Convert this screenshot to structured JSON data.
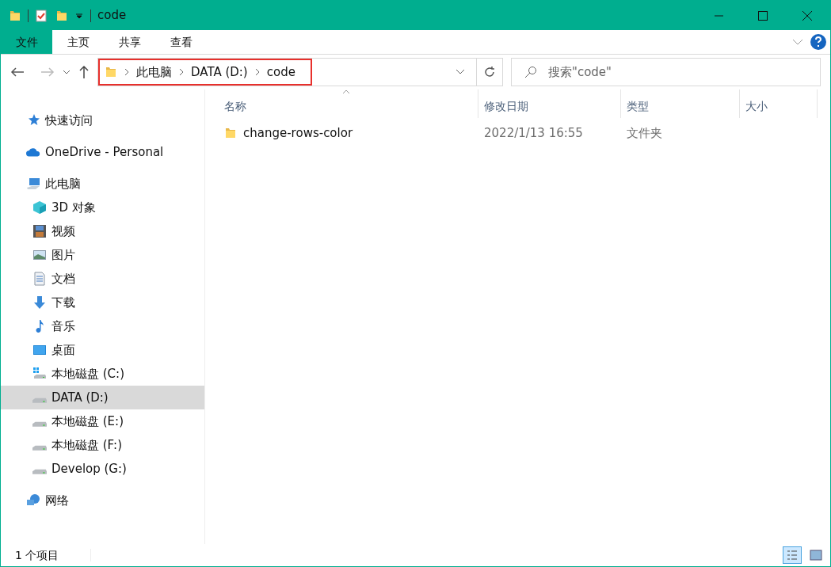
{
  "window": {
    "title": "code"
  },
  "ribbon": {
    "tabs": [
      {
        "label": "文件",
        "selected": true
      },
      {
        "label": "主页",
        "selected": false
      },
      {
        "label": "共享",
        "selected": false
      },
      {
        "label": "查看",
        "selected": false
      }
    ]
  },
  "address_bar": {
    "crumbs": [
      "此电脑",
      "DATA (D:)",
      "code"
    ]
  },
  "search": {
    "placeholder": "搜索\"code\""
  },
  "sidebar": {
    "items": [
      {
        "label": "快速访问",
        "kind": "star",
        "selected": false
      },
      {
        "label": "OneDrive - Personal",
        "kind": "cloud",
        "selected": false
      },
      {
        "label": "此电脑",
        "kind": "pc",
        "selected": false,
        "children": [
          {
            "label": "3D 对象",
            "kind": "cube",
            "selected": false
          },
          {
            "label": "视频",
            "kind": "film",
            "selected": false
          },
          {
            "label": "图片",
            "kind": "image",
            "selected": false
          },
          {
            "label": "文档",
            "kind": "doc",
            "selected": false
          },
          {
            "label": "下载",
            "kind": "download",
            "selected": false
          },
          {
            "label": "音乐",
            "kind": "music",
            "selected": false
          },
          {
            "label": "桌面",
            "kind": "desktop",
            "selected": false
          },
          {
            "label": "本地磁盘 (C:)",
            "kind": "system-drive",
            "selected": false
          },
          {
            "label": "DATA (D:)",
            "kind": "drive",
            "selected": true
          },
          {
            "label": "本地磁盘 (E:)",
            "kind": "drive",
            "selected": false
          },
          {
            "label": "本地磁盘 (F:)",
            "kind": "drive",
            "selected": false
          },
          {
            "label": "Develop (G:)",
            "kind": "drive",
            "selected": false
          }
        ]
      },
      {
        "label": "网络",
        "kind": "network",
        "selected": false
      }
    ]
  },
  "table": {
    "columns": [
      "名称",
      "修改日期",
      "类型",
      "大小"
    ],
    "rows": [
      {
        "name": "change-rows-color",
        "modified": "2022/1/13 16:55",
        "type": "文件夹",
        "size_column": ""
      }
    ]
  },
  "status_bar": {
    "text": "1 个项目"
  }
}
